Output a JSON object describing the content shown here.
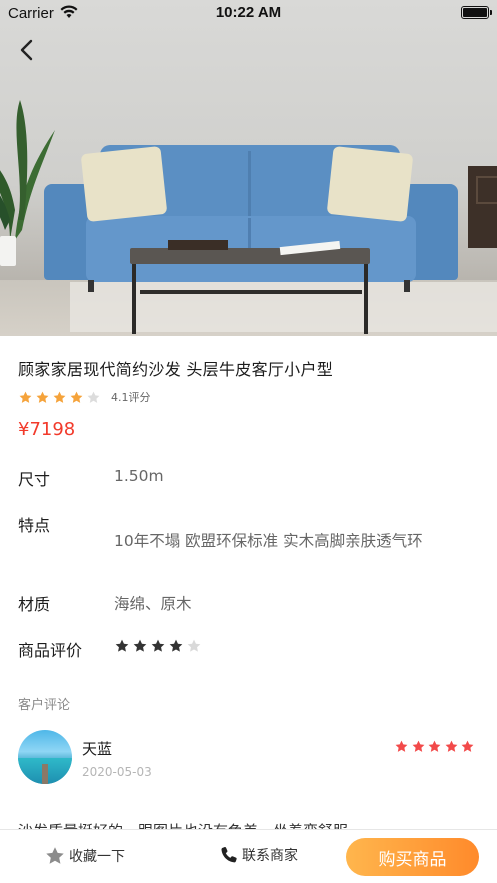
{
  "status_bar": {
    "carrier": "Carrier",
    "time": "10:22 AM"
  },
  "product": {
    "title": "顾家家居现代简约沙发 头层牛皮客厅小户型",
    "rating_stars": 4,
    "rating_max": 5,
    "rating_text": "4.1评分",
    "price": "¥7198"
  },
  "specs": [
    {
      "label": "尺寸",
      "value": "1.50m"
    },
    {
      "label": "特点",
      "value": "10年不塌 欧盟环保标准 实木高脚亲肤透气环"
    },
    {
      "label": "材质",
      "value": "海绵、原木"
    },
    {
      "label": "商品评价",
      "stars": 4,
      "max": 5
    }
  ],
  "reviews": {
    "section_title": "客户评论",
    "items": [
      {
        "name": "天蓝",
        "date": "2020-05-03",
        "stars": 5,
        "text": "沙发质量挺好的，跟图片也没有色差，坐着蛮舒服~"
      }
    ]
  },
  "bottom_bar": {
    "favorite_label": "收藏一下",
    "contact_label": "联系商家",
    "buy_label": "购买商品"
  },
  "colors": {
    "price": "#f23a2b",
    "rating_star": "#f5a33b",
    "review_star": "#f24a4a",
    "buy_gradient_start": "#ffb64d",
    "buy_gradient_end": "#ff8a2b"
  },
  "icons": {
    "back": "chevron-left-icon",
    "favorite": "star-icon",
    "contact": "phone-icon",
    "wifi": "wifi-icon",
    "battery": "battery-icon"
  }
}
